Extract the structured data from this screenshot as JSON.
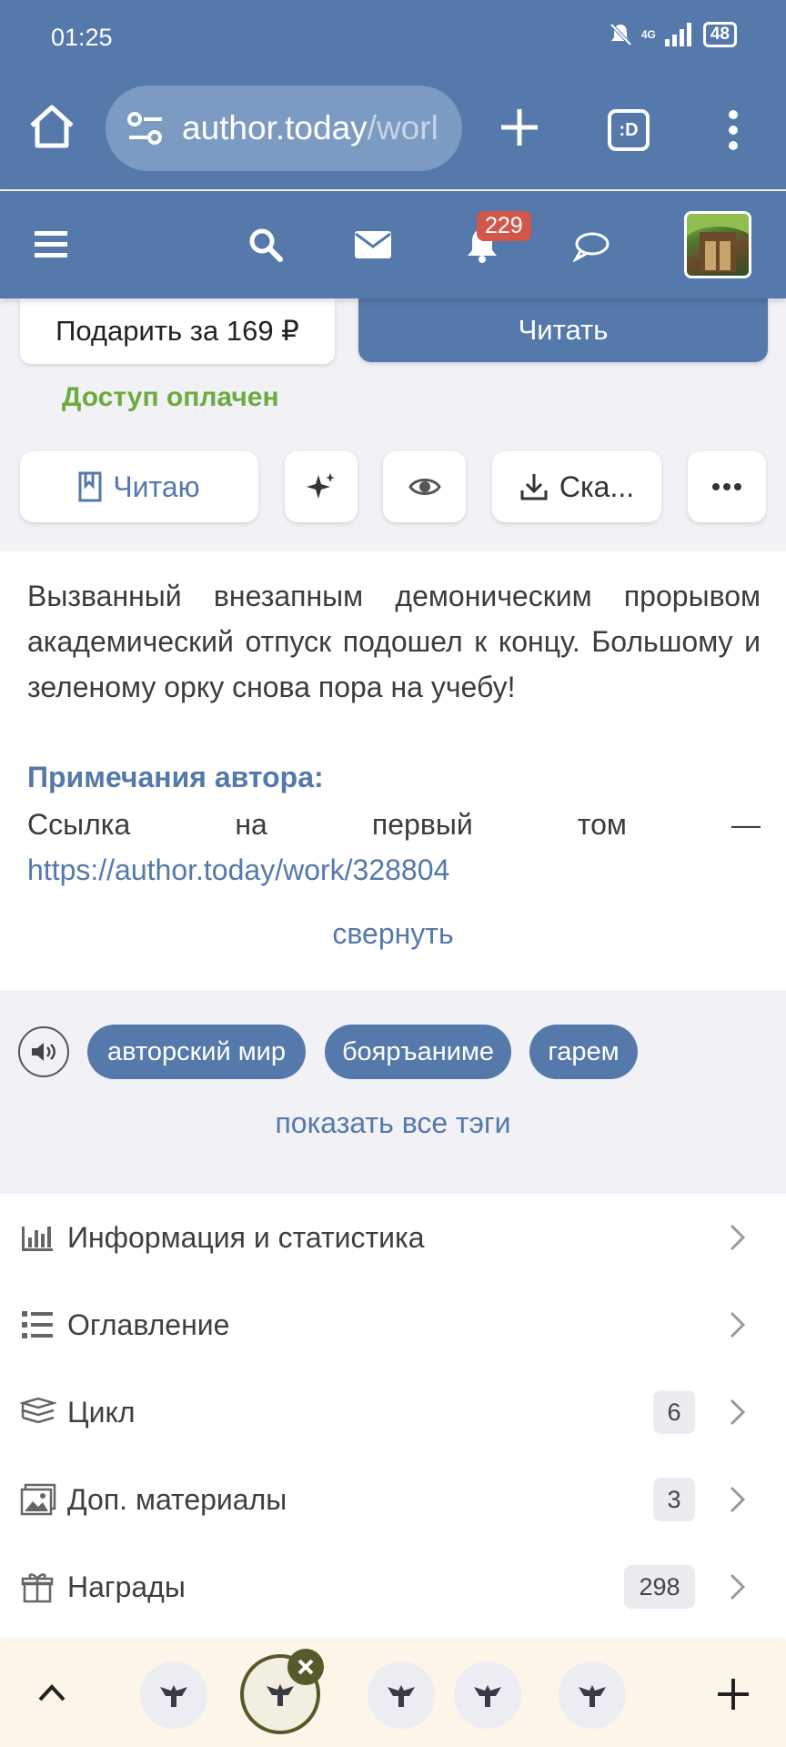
{
  "status_bar": {
    "time": "01:25",
    "network": "4G",
    "battery": "48"
  },
  "browser": {
    "url_host": "author.today",
    "url_path": "/worl",
    "tabs_label": ":D",
    "icons": [
      "home-icon",
      "site-settings-icon",
      "new-tab-icon",
      "tabs-icon",
      "menu-icon"
    ]
  },
  "navbar": {
    "notifications_count": "229",
    "icons": [
      "hamburger-icon",
      "search-icon",
      "mail-icon",
      "bell-icon",
      "chat-icon",
      "avatar"
    ]
  },
  "buy": {
    "gift_label": "Подарить за 169 ₽",
    "read_label": "Читать",
    "access_label": "Доступ оплачен"
  },
  "actions": {
    "reading_label": "Читаю",
    "download_label": "Ска..."
  },
  "description": {
    "text": "Вызванный внезапным демоническим прорывом академический отпуск подошел к концу. Большому и зеленому орку снова пора на учебу!",
    "notes_title": "Примечания автора:",
    "notes_words": [
      "Ссылка",
      "на",
      "первый",
      "том",
      "—"
    ],
    "notes_link": "https://author.today/work/328804",
    "collapse_label": "свернуть"
  },
  "tags": {
    "items": [
      "авторский мир",
      "бояръаниме",
      "гарем"
    ],
    "show_all_label": "показать все тэги"
  },
  "menu": [
    {
      "label": "Информация и статистика",
      "count": "",
      "icon": "stats-icon"
    },
    {
      "label": "Оглавление",
      "count": "",
      "icon": "list-icon"
    },
    {
      "label": "Цикл",
      "count": "6",
      "icon": "books-icon"
    },
    {
      "label": "Доп. материалы",
      "count": "3",
      "icon": "image-icon"
    },
    {
      "label": "Награды",
      "count": "298",
      "icon": "gift-icon"
    }
  ],
  "colors": {
    "brand_blue": "#5479aa",
    "access_green": "#6aac3e",
    "badge_red": "#d2574a",
    "bottom_bar": "#fcf6e8"
  }
}
